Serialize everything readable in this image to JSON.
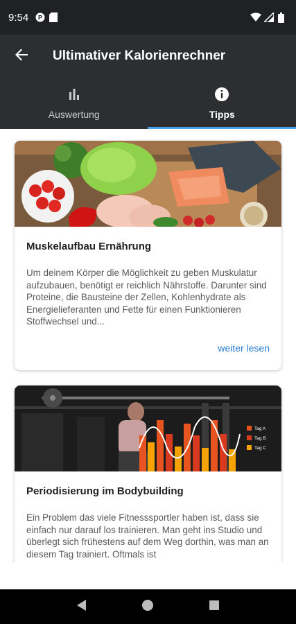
{
  "status_bar": {
    "time": "9:54",
    "icons": [
      "notification-p-icon",
      "sd-card-icon",
      "wifi-icon",
      "signal-icon",
      "battery-icon"
    ]
  },
  "app_bar": {
    "title": "Ultimativer Kalorienrechner",
    "back_icon": "arrow-back-icon"
  },
  "tabs": [
    {
      "label": "Auswertung",
      "icon": "bar-chart-icon",
      "active": false
    },
    {
      "label": "Tipps",
      "icon": "info-icon",
      "active": true
    }
  ],
  "cards": [
    {
      "image": "healthy-food-photo",
      "title": "Muskelaufbau Ernährung",
      "text": "Um deinem Körper die Möglichkeit zu geben Muskulatur aufzubauen, benötigt er reichlich Nährstoffe. Darunter sind Proteine, die Bausteine der Zellen, Kohlenhydrate als Energielieferanten und Fette für einen Funktionieren Stoffwechsel und...",
      "link": "weiter lesen"
    },
    {
      "image": "gym-periodization-photo",
      "image_legend": [
        "Tag A",
        "Tag B",
        "Tag C"
      ],
      "title": "Periodisierung im Bodybuilding",
      "text": "Ein Problem das viele Fitnesssportler haben ist, dass sie einfach nur darauf los trainieren. Man geht ins Studio und überlegt sich frühestens auf dem Weg dorthin, was man an diesem Tag trainiert. Oftmals ist"
    }
  ],
  "nav_bar": {
    "buttons": [
      "back-triangle-icon",
      "home-circle-icon",
      "recents-square-icon"
    ]
  },
  "colors": {
    "status_bar": "#202124",
    "app_bar": "#2d2e31",
    "tab_indicator": "#4a9eea",
    "link": "#2a7fd4"
  }
}
